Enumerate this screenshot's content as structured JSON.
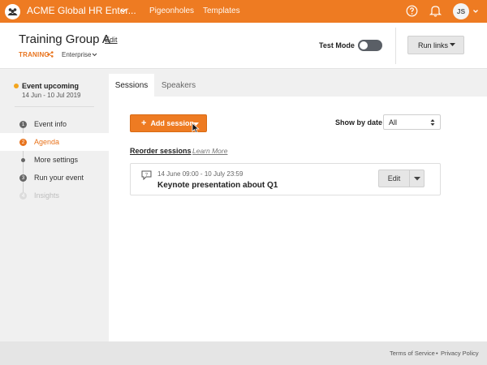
{
  "topbar": {
    "org_name": "ACME Global HR Enter...",
    "nav": [
      "Pigeonholes",
      "Templates"
    ],
    "avatar_initials": "JS",
    "accent": "#ee7b22"
  },
  "header": {
    "title": "Training Group A",
    "edit_label": "Edit",
    "group_tag": "TRANING",
    "plan": "Enterprise",
    "test_mode_label": "Test Mode",
    "test_mode_on": false,
    "run_links_label": "Run links"
  },
  "sidebar": {
    "status": "Event upcoming",
    "dates": "14 Jun - 10 Jul 2019",
    "status_color": "#f3a51e",
    "items": [
      {
        "step": "1",
        "label": "Event info",
        "state": "default"
      },
      {
        "step": "2",
        "label": "Agenda",
        "state": "active"
      },
      {
        "step": "",
        "label": "More settings",
        "state": "sub"
      },
      {
        "step": "3",
        "label": "Run your event",
        "state": "default"
      },
      {
        "step": "4",
        "label": "Insights",
        "state": "disabled"
      }
    ]
  },
  "main": {
    "tabs": [
      "Sessions",
      "Speakers"
    ],
    "active_tab": "Sessions",
    "add_session_label": "Add session",
    "show_by_label": "Show by date",
    "date_filter_value": "All",
    "reorder_label": "Reorder sessions",
    "learn_more_label": "Learn More",
    "sessions": [
      {
        "time": "14 June 09:00 - 10 July 23:59",
        "title": "Keynote presentation about Q1",
        "icon": "qa-icon",
        "edit_label": "Edit"
      }
    ]
  },
  "footer": {
    "terms": "Terms of Service",
    "separator": "•",
    "privacy": "Privacy Policy"
  }
}
